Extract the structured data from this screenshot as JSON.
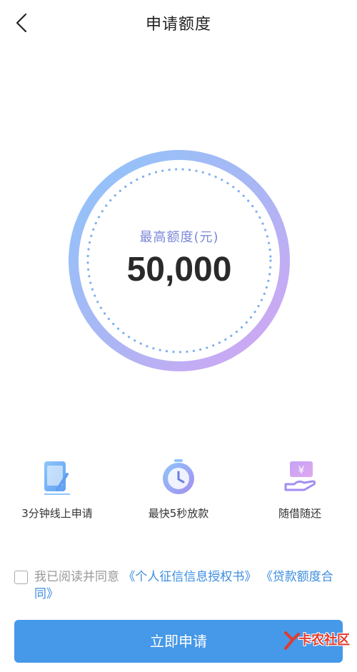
{
  "header": {
    "title": "申请额度",
    "back_icon": "chevron-left-icon"
  },
  "limit": {
    "label": "最高额度(元)",
    "value": "50,000"
  },
  "features": [
    {
      "label": "3分钟线上申请",
      "icon": "phone-pen-icon"
    },
    {
      "label": "最快5秒放款",
      "icon": "clock-icon"
    },
    {
      "label": "随借随还",
      "icon": "yuan-hand-icon"
    }
  ],
  "agreement": {
    "prefix": "我已阅读并同意",
    "link1": "《个人征信信息授权书》",
    "link2": "《贷款额度合同》"
  },
  "submit": {
    "label": "立即申请"
  },
  "watermark": {
    "text": "卡农社区"
  },
  "colors": {
    "accent": "#4698e8",
    "link": "#3c8ddf",
    "gauge_start": "#8ec5fb",
    "gauge_end": "#d8a3f3"
  }
}
